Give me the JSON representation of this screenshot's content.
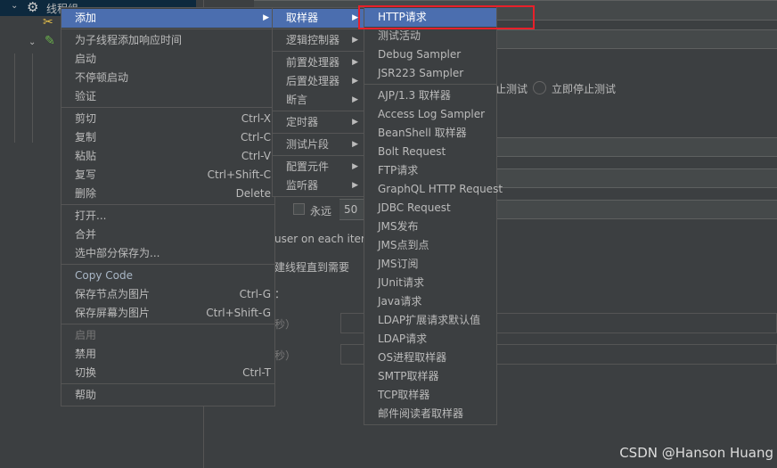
{
  "tree": {
    "thread_group": "线程组"
  },
  "main_menu": [
    {
      "label": "添加",
      "submenu": true,
      "highlighted": true
    },
    {
      "sep": true
    },
    {
      "label": "为子线程添加响应时间"
    },
    {
      "label": "启动"
    },
    {
      "label": "不停顿启动"
    },
    {
      "label": "验证"
    },
    {
      "sep": true
    },
    {
      "label": "剪切",
      "shortcut": "Ctrl-X"
    },
    {
      "label": "复制",
      "shortcut": "Ctrl-C"
    },
    {
      "label": "粘贴",
      "shortcut": "Ctrl-V"
    },
    {
      "label": "复写",
      "shortcut": "Ctrl+Shift-C"
    },
    {
      "label": "删除",
      "shortcut": "Delete"
    },
    {
      "sep": true
    },
    {
      "label": "打开..."
    },
    {
      "label": "合并"
    },
    {
      "label": "选中部分保存为..."
    },
    {
      "sep": true
    },
    {
      "label": "Copy Code",
      "style": "code"
    },
    {
      "label": "保存节点为图片",
      "shortcut": "Ctrl-G"
    },
    {
      "label": "保存屏幕为图片",
      "shortcut": "Ctrl+Shift-G"
    },
    {
      "sep": true
    },
    {
      "label": "启用",
      "disabled": true
    },
    {
      "label": "禁用"
    },
    {
      "label": "切换",
      "shortcut": "Ctrl-T"
    },
    {
      "sep": true
    },
    {
      "label": "帮助"
    }
  ],
  "add_menu": [
    {
      "label": "取样器",
      "submenu": true,
      "highlighted": true
    },
    {
      "sep": true
    },
    {
      "label": "逻辑控制器",
      "submenu": true
    },
    {
      "sep": true
    },
    {
      "label": "前置处理器",
      "submenu": true
    },
    {
      "label": "后置处理器",
      "submenu": true
    },
    {
      "label": "断言",
      "submenu": true
    },
    {
      "sep": true
    },
    {
      "label": "定时器",
      "submenu": true
    },
    {
      "sep": true
    },
    {
      "label": "测试片段",
      "submenu": true
    },
    {
      "sep": true
    },
    {
      "label": "配置元件",
      "submenu": true
    },
    {
      "label": "监听器",
      "submenu": true
    }
  ],
  "sampler_menu": [
    {
      "label": "HTTP请求",
      "highlighted": true
    },
    {
      "label": "测试活动"
    },
    {
      "label": "Debug Sampler"
    },
    {
      "label": "JSR223 Sampler"
    },
    {
      "sep": true
    },
    {
      "label": "AJP/1.3 取样器"
    },
    {
      "label": "Access Log Sampler"
    },
    {
      "label": "BeanShell 取样器"
    },
    {
      "label": "Bolt Request"
    },
    {
      "label": "FTP请求"
    },
    {
      "label": "GraphQL HTTP Request"
    },
    {
      "label": "JDBC Request"
    },
    {
      "label": "JMS发布"
    },
    {
      "label": "JMS点到点"
    },
    {
      "label": "JMS订阅"
    },
    {
      "label": "JUnit请求"
    },
    {
      "label": "Java请求"
    },
    {
      "label": "LDAP扩展请求默认值"
    },
    {
      "label": "LDAP请求"
    },
    {
      "label": "OS进程取样器"
    },
    {
      "label": "SMTP取样器"
    },
    {
      "label": "TCP取样器"
    },
    {
      "label": "邮件阅读者取样器"
    }
  ],
  "panel": {
    "stop_test_partial": "止测试",
    "stop_now": "立即停止测试",
    "forever": "永远",
    "loop_count": "50",
    "same_user": "user on each iterati",
    "delay_create": "建线程直到需要",
    "sec1": "秒）",
    "sec2": "秒）",
    "colon": "："
  },
  "watermark": "CSDN @Hanson Huang",
  "colors": {
    "highlight": "#4b6eaf",
    "annotation": "#e8202a"
  }
}
